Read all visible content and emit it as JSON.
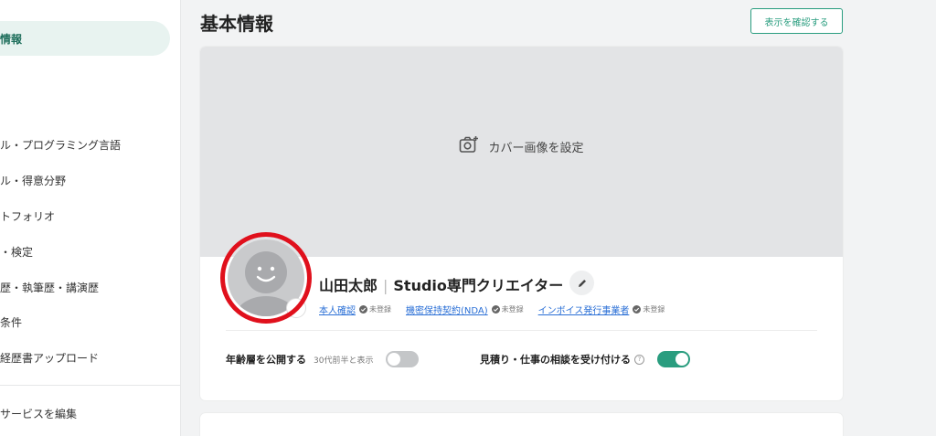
{
  "sidebar": {
    "items": [
      {
        "label": "情報",
        "active": true
      },
      {
        "label": "ル・プログラミング言語"
      },
      {
        "label": "ル・得意分野"
      },
      {
        "label": "トフォリオ"
      },
      {
        "label": "・検定"
      },
      {
        "label": "歴・執筆歴・講演歴"
      },
      {
        "label": "条件"
      },
      {
        "label": "経歴書アップロード"
      },
      {
        "label": "サービスを編集"
      }
    ]
  },
  "header": {
    "title": "基本情報",
    "confirm_label": "表示を確認する"
  },
  "cover": {
    "label": "カバー画像を設定"
  },
  "profile": {
    "name": "山田太郎",
    "separator": "|",
    "tagline": "Studio専門クリエイター",
    "links": [
      {
        "label": "本人確認",
        "status": "未登録"
      },
      {
        "label": "機密保持契約(NDA)",
        "status": "未登録"
      },
      {
        "label": "インボイス発行事業者",
        "status": "未登録"
      }
    ]
  },
  "settings": {
    "age": {
      "label": "年齢層を公開する",
      "sub": "30代前半と表示",
      "enabled": false
    },
    "consult": {
      "label": "見積り・仕事の相談を受け付ける",
      "help": "?",
      "enabled": true
    }
  },
  "colors": {
    "accent": "#2a9d7f",
    "highlight_ring": "#e0101c",
    "link": "#2a6fd6"
  }
}
